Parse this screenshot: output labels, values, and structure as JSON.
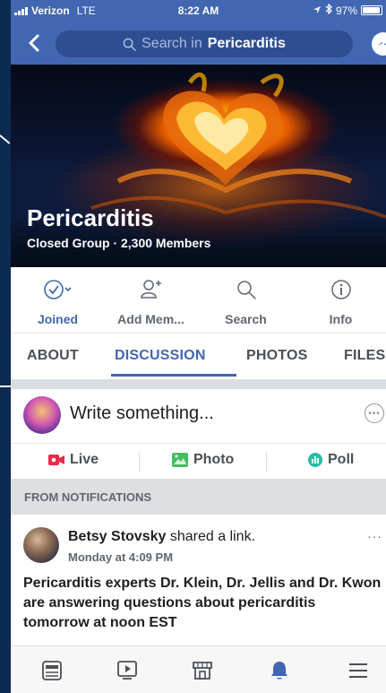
{
  "status_bar": {
    "carrier": "Verizon",
    "network": "LTE",
    "time": "8:22 AM",
    "battery": "97%",
    "battery_level": 0.97,
    "icons": [
      "signal-icon",
      "location-icon",
      "bluetooth-icon",
      "battery-icon"
    ]
  },
  "nav": {
    "back_icon": "chevron-left-icon",
    "search_prefix": "Search in",
    "search_group": "Pericarditis",
    "messenger_icon": "messenger-icon"
  },
  "cover": {
    "group_name": "Pericarditis",
    "group_meta": "Closed Group · 2,300 Members"
  },
  "actions": [
    {
      "label": "Joined",
      "icon": "check-circle-icon",
      "active": true
    },
    {
      "label": "Add Mem...",
      "icon": "add-person-icon",
      "active": false
    },
    {
      "label": "Search",
      "icon": "search-icon",
      "active": false
    },
    {
      "label": "Info",
      "icon": "info-icon",
      "active": false
    }
  ],
  "tabs": [
    {
      "label": "ABOUT",
      "active": false
    },
    {
      "label": "DISCUSSION",
      "active": true
    },
    {
      "label": "PHOTOS",
      "active": false
    },
    {
      "label": "FILES",
      "active": false
    }
  ],
  "composer": {
    "placeholder": "Write something...",
    "buttons": [
      {
        "label": "Live",
        "icon": "live-video-icon",
        "color": "#f02849"
      },
      {
        "label": "Photo",
        "icon": "photo-icon",
        "color": "#45bd62"
      },
      {
        "label": "Poll",
        "icon": "poll-icon",
        "color": "#2abba7"
      }
    ]
  },
  "notifications": {
    "header": "FROM NOTIFICATIONS"
  },
  "post": {
    "author": "Betsy Stovsky",
    "action": "shared a link.",
    "time": "Monday at 4:09 PM",
    "more": "···",
    "body": "Pericarditis experts Dr. Klein, Dr. Jellis and Dr. Kwon are answering questions about pericarditis tomorrow at noon EST"
  },
  "bottom_bar": [
    "news-feed-icon",
    "watch-icon",
    "marketplace-icon",
    "notifications-bell-icon",
    "menu-icon"
  ],
  "colors": {
    "brand": "#4267b2",
    "text": "#1c1e21",
    "muted": "#606770",
    "frame": "#0d2a52"
  }
}
